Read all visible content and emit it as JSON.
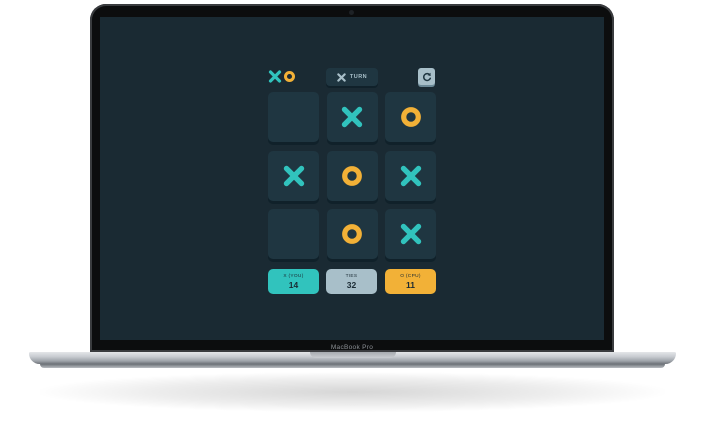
{
  "device": {
    "brand_label": "MacBook Pro"
  },
  "colors": {
    "x": "#31C3BD",
    "o": "#F2B137",
    "ties": "#A8BFC9",
    "background": "#1A2A33",
    "tile": "#1F3641"
  },
  "header": {
    "logo": [
      "x-mark",
      "o-mark"
    ],
    "turn": {
      "mark": "X",
      "label": "TURN"
    },
    "restart_icon": "restart-icon"
  },
  "board": [
    "",
    "X",
    "O",
    "X",
    "O",
    "X",
    "",
    "O",
    "X"
  ],
  "scores": {
    "x": {
      "label": "X (YOU)",
      "value": "14"
    },
    "ties": {
      "label": "TIES",
      "value": "32"
    },
    "o": {
      "label": "O (CPU)",
      "value": "11"
    }
  }
}
